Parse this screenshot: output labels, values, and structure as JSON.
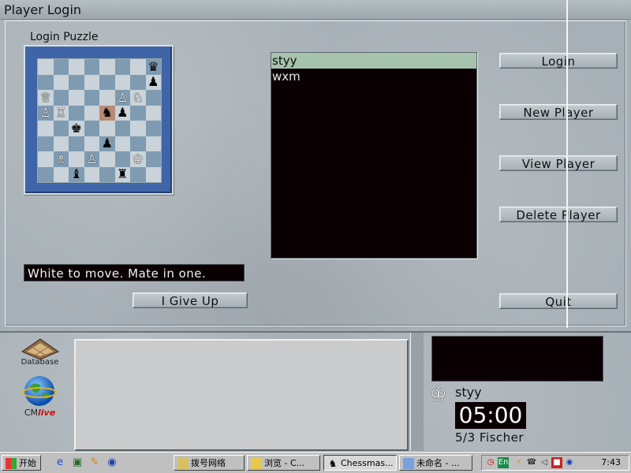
{
  "window": {
    "title": "Player Login"
  },
  "puzzle": {
    "label": "Login Puzzle",
    "status": "White to move. Mate in one.",
    "board": [
      [
        "",
        "",
        "",
        "",
        "",
        "",
        "",
        ""
      ],
      [
        "",
        "",
        "",
        "",
        "",
        "",
        "",
        "♛"
      ],
      [
        "",
        "",
        "",
        "",
        "",
        "",
        "",
        "♟"
      ],
      [
        "♕",
        "",
        "",
        "",
        "",
        "♙",
        "♘",
        ""
      ],
      [
        "♙",
        "♖",
        "",
        "",
        "♞",
        "♟",
        "",
        ""
      ],
      [
        "",
        "",
        "♚",
        "",
        "",
        "",
        "",
        ""
      ],
      [
        "",
        "",
        "",
        "",
        "♟",
        "",
        "",
        ""
      ],
      [
        "",
        "♗",
        "",
        "♙",
        "",
        "",
        "♔",
        ""
      ],
      [
        "",
        "",
        "♝",
        "",
        "",
        "♜",
        "",
        ""
      ]
    ]
  },
  "players": {
    "items": [
      "styy",
      "wxm"
    ],
    "selected": "styy"
  },
  "buttons": {
    "login": "Login",
    "new_player": "New Player",
    "view_player": "View Player",
    "delete_player": "Delete Player",
    "give_up": "I Give Up",
    "quit": "Quit"
  },
  "sidebar": {
    "database_label": "Database",
    "cm_prefix": "CM",
    "cm_live": "live"
  },
  "game_panel": {
    "player": "styy",
    "clock": "05:00",
    "time_control": "5/3 Fischer"
  },
  "taskbar": {
    "start": "开始",
    "tasks": [
      {
        "label": "拨号网络",
        "active": false
      },
      {
        "label": "浏览 - C...",
        "active": false
      },
      {
        "label": "Chessmas...",
        "active": true
      },
      {
        "label": "未命名 - ...",
        "active": false
      }
    ],
    "tray_lang": "En",
    "time": "7:43"
  },
  "colors": {
    "board_frame": "#3f65a8",
    "light_square": "#c9d3d9",
    "dark_square": "#7f9bb2",
    "highlight_square": "#b98a74",
    "selected_row": "#a6c3ad"
  }
}
